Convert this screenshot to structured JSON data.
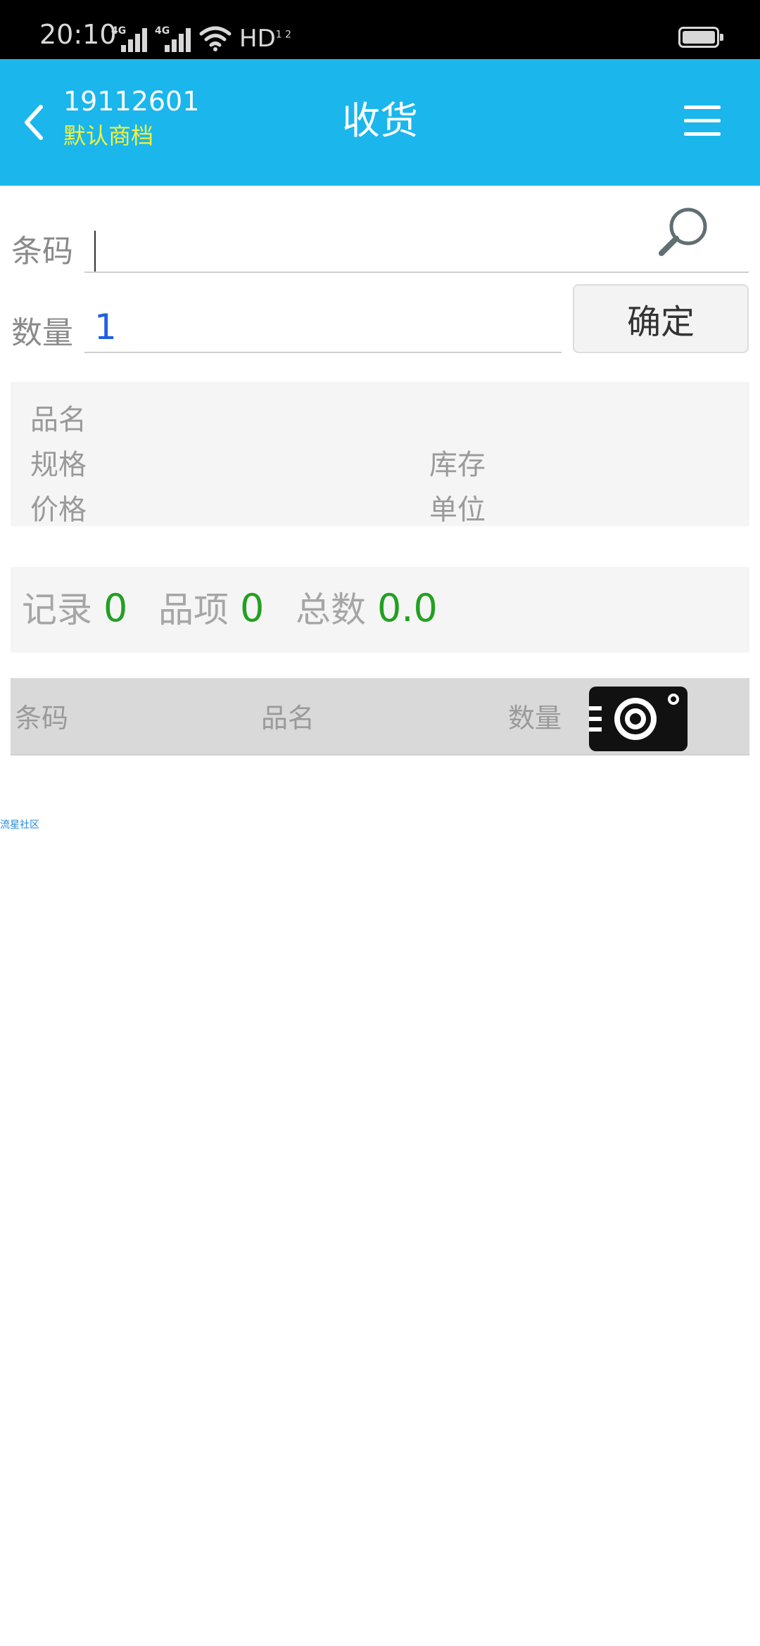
{
  "status_bar": {
    "time": "20:10",
    "network_1": "4G",
    "network_2": "4G",
    "hd": "HD",
    "hd_sup": "1 2"
  },
  "header": {
    "store_id": "19112601",
    "store_name": "默认商档",
    "title": "收货",
    "back_icon": "chevron-left-icon",
    "menu_icon": "hamburger-menu-icon"
  },
  "form": {
    "barcode_label": "条码",
    "barcode_value": "",
    "search_icon": "magnifier-icon",
    "quantity_label": "数量",
    "quantity_value": "1",
    "confirm_label": "确定"
  },
  "product_info": {
    "name_label": "品名",
    "spec_label": "规格",
    "stock_label": "库存",
    "price_label": "价格",
    "unit_label": "单位"
  },
  "summary": {
    "records_label": "记录",
    "records_value": "0",
    "items_label": "品项",
    "items_value": "0",
    "total_label": "总数",
    "total_value": "0.0"
  },
  "table": {
    "columns": [
      "条码",
      "品名",
      "数量"
    ],
    "camera_icon": "camera-scan-icon"
  },
  "footer": {
    "link_text": "流星社区"
  },
  "colors": {
    "header_bg": "#1ab6ec",
    "store_name": "#f6f23a",
    "quantity_value": "#2260e0",
    "summary_value": "#22a022"
  }
}
